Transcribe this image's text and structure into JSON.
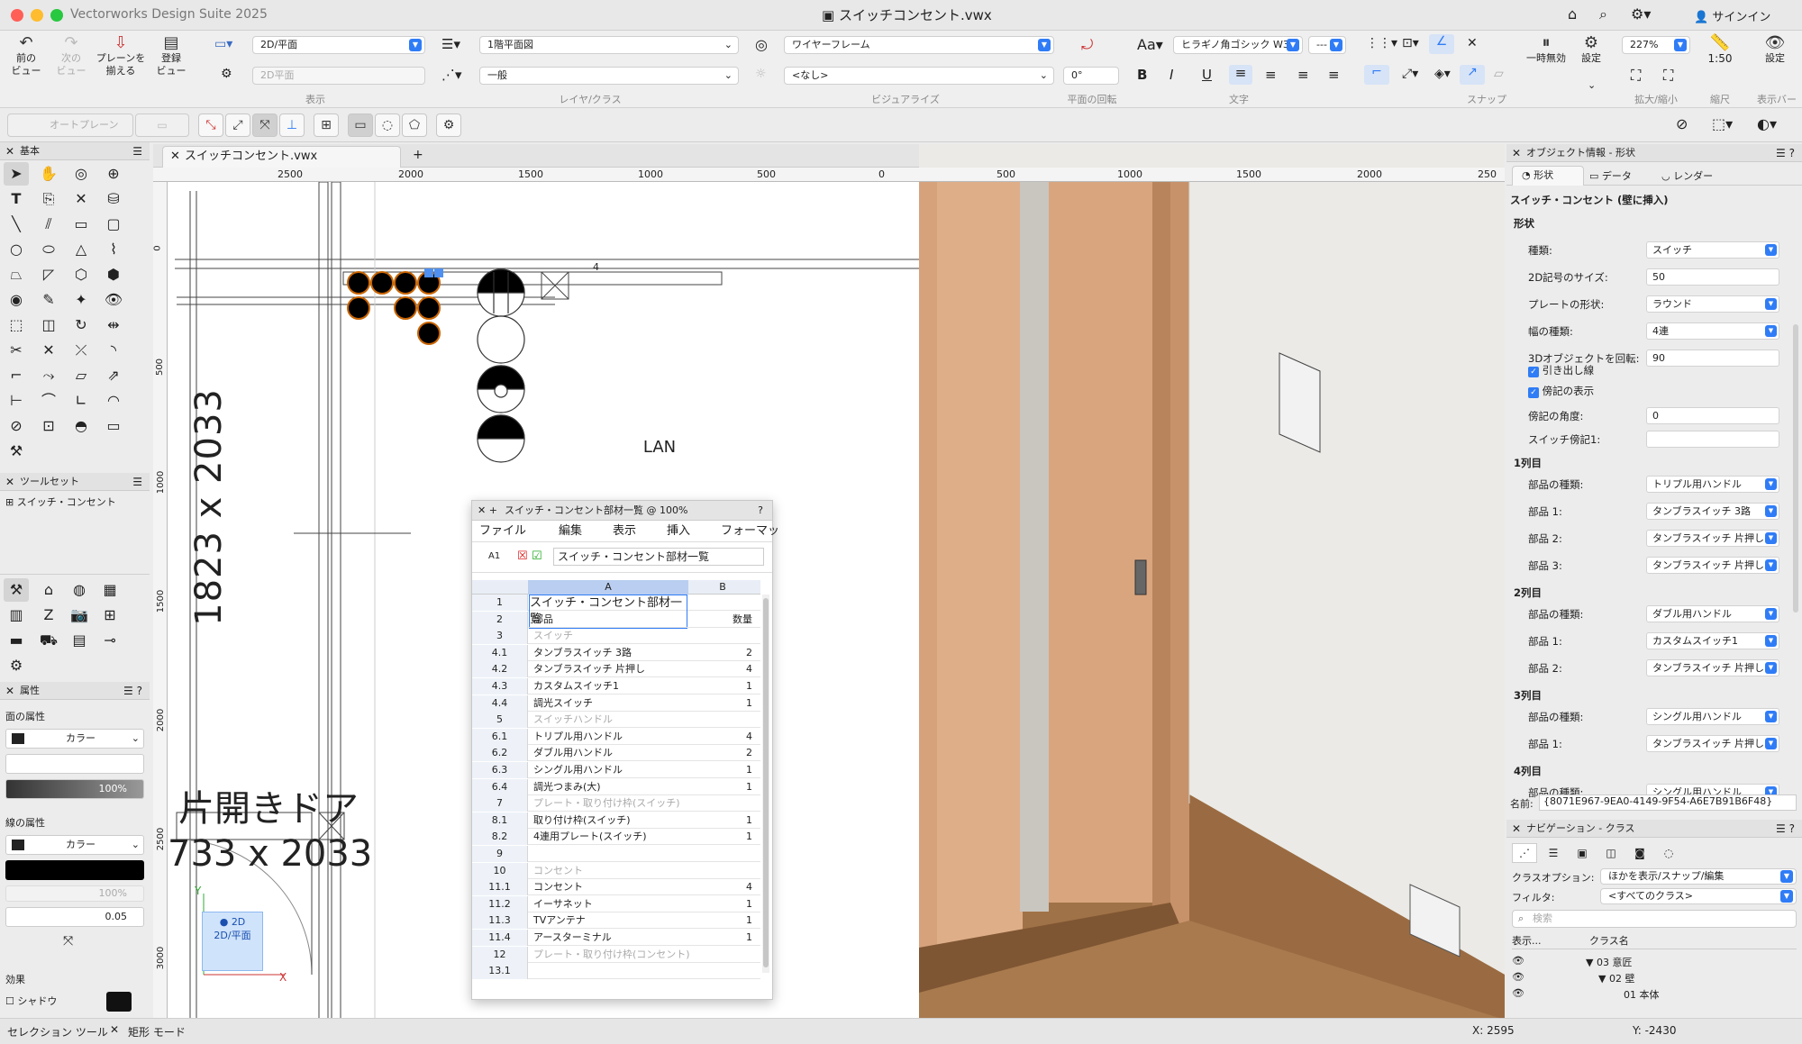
{
  "app": {
    "name": "Vectorworks Design Suite 2025",
    "doc_title": "スイッチコンセント.vwx",
    "signin": "サインイン"
  },
  "colors": {
    "accent": "#2f7cf6",
    "close": "#ff5f57",
    "min": "#febc2e",
    "max": "#28c840"
  },
  "toolbar": {
    "prev_view": "前の\nビュー",
    "next_view": "次の\nビュー",
    "align_planes": "プレーンを\n揃える",
    "register_view": "登録\nビュー",
    "view_dd1": "2D/平面",
    "view_dd2": "2D平面",
    "view_group": "表示",
    "layer_dd": "1階平面図",
    "class_dd": "一般",
    "layer_group": "レイヤ/クラス",
    "render_dd": "ワイヤーフレーム",
    "render_dd2": "<なし>",
    "visualize_group": "ビジュアライズ",
    "rotation": "0°",
    "rotation_group": "平面の回転",
    "font": "ヒラギノ角ゴシック W3",
    "font_size": "---",
    "text_group": "文字",
    "snap_group": "スナップ",
    "pause": "一時無効",
    "settings": "設定",
    "zoom": "227%",
    "zoom_group": "拡大/縮小",
    "scale": "1:50",
    "scale_group": "縮尺",
    "display_settings": "設定",
    "display_group": "表示バー"
  },
  "modebar": {
    "auto_plane": "オートプレーン"
  },
  "basic_palette": {
    "title": "基本"
  },
  "toolset": {
    "title": "ツールセット",
    "item": "スイッチ・コンセント"
  },
  "attributes": {
    "title": "属性",
    "fill_label": "面の属性",
    "fill_type": "カラー",
    "opacity": "100%",
    "line_label": "線の属性",
    "line_type": "カラー",
    "line_opacity": "100%",
    "line_weight": "0.05",
    "effects": "効果",
    "shadow": "シャドウ"
  },
  "doc_tab": "スイッチコンセント.vwx",
  "ruler_top": [
    "2500",
    "2000",
    "1500",
    "1000",
    "500",
    "0",
    "500",
    "1000",
    "1500",
    "2000",
    "250"
  ],
  "ruler_left": [
    "0",
    "500",
    "1000",
    "1500",
    "2000",
    "2500",
    "3000"
  ],
  "drawing": {
    "wall_label1": "1823 x 2033",
    "door_label": "片開きドア",
    "door_size": "733 x 2033",
    "lan": "LAN",
    "plane_badge": "2D/平面",
    "plane_badge_top": "2D",
    "axis_x": "X",
    "axis_y": "Y",
    "num4": "4"
  },
  "sheet": {
    "title": "スイッチ・コンセント部材一覧 @ 100%",
    "menu": [
      "ファイル",
      "編集",
      "表示",
      "挿入",
      "フォーマッ"
    ],
    "cell_ref": "A1",
    "formula": "スイッチ・コンセント部材一覧",
    "col_a": "A",
    "col_b": "B",
    "rows": [
      {
        "n": "1",
        "a": "スイッチ・コンセント部材一覧",
        "b": "",
        "t": "title"
      },
      {
        "n": "2",
        "a": "部品",
        "b": "数量",
        "t": "hdr"
      },
      {
        "n": "3",
        "a": "スイッチ",
        "b": "",
        "t": "g"
      },
      {
        "n": "4.1",
        "a": "タンブラスイッチ 3路",
        "b": "2",
        "t": ""
      },
      {
        "n": "4.2",
        "a": "タンブラスイッチ 片押し",
        "b": "4",
        "t": ""
      },
      {
        "n": "4.3",
        "a": "カスタムスイッチ1",
        "b": "1",
        "t": ""
      },
      {
        "n": "4.4",
        "a": "調光スイッチ",
        "b": "1",
        "t": ""
      },
      {
        "n": "5",
        "a": "スイッチハンドル",
        "b": "",
        "t": "g"
      },
      {
        "n": "6.1",
        "a": "トリプル用ハンドル",
        "b": "4",
        "t": ""
      },
      {
        "n": "6.2",
        "a": "ダブル用ハンドル",
        "b": "2",
        "t": ""
      },
      {
        "n": "6.3",
        "a": "シングル用ハンドル",
        "b": "1",
        "t": ""
      },
      {
        "n": "6.4",
        "a": "調光つまみ(大)",
        "b": "1",
        "t": ""
      },
      {
        "n": "7",
        "a": "プレート・取り付け枠(スイッチ)",
        "b": "",
        "t": "g"
      },
      {
        "n": "8.1",
        "a": "取り付け枠(スイッチ)",
        "b": "1",
        "t": ""
      },
      {
        "n": "8.2",
        "a": "4連用プレート(スイッチ)",
        "b": "1",
        "t": ""
      },
      {
        "n": "9",
        "a": "",
        "b": "",
        "t": ""
      },
      {
        "n": "10",
        "a": "コンセント",
        "b": "",
        "t": "g"
      },
      {
        "n": "11.1",
        "a": "コンセント",
        "b": "4",
        "t": ""
      },
      {
        "n": "11.2",
        "a": "イーサネット",
        "b": "1",
        "t": ""
      },
      {
        "n": "11.3",
        "a": "TVアンテナ",
        "b": "1",
        "t": ""
      },
      {
        "n": "11.4",
        "a": "アースターミナル",
        "b": "1",
        "t": ""
      },
      {
        "n": "12",
        "a": "プレート・取り付け枠(コンセント)",
        "b": "",
        "t": "g"
      },
      {
        "n": "13.1",
        "a": "",
        "b": "",
        "t": ""
      }
    ]
  },
  "objinfo": {
    "title": "オブジェクト情報 - 形状",
    "tabs": [
      "形状",
      "データ",
      "レンダー"
    ],
    "object": "スイッチ・コンセント (壁に挿入)",
    "section_shape": "形状",
    "fields": [
      {
        "label": "種類:",
        "value": "スイッチ",
        "sel": true
      },
      {
        "label": "2D記号のサイズ:",
        "value": "50",
        "sel": false
      },
      {
        "label": "プレートの形状:",
        "value": "ラウンド",
        "sel": true
      },
      {
        "label": "幅の種類:",
        "value": "4連",
        "sel": true
      },
      {
        "label": "3Dオブジェクトを回転:",
        "value": "90",
        "sel": false
      }
    ],
    "check1": "引き出し線",
    "check2": "傍記の表示",
    "angle_label": "傍記の角度:",
    "angle_value": "0",
    "switch_note": "スイッチ傍記1:",
    "col1": "1列目",
    "col1_fields": [
      {
        "label": "部品の種類:",
        "value": "トリプル用ハンドル"
      },
      {
        "label": "部品 1:",
        "value": "タンブラスイッチ 3路"
      },
      {
        "label": "部品 2:",
        "value": "タンブラスイッチ 片押し"
      },
      {
        "label": "部品 3:",
        "value": "タンブラスイッチ 片押し"
      }
    ],
    "col2": "2列目",
    "col2_fields": [
      {
        "label": "部品の種類:",
        "value": "ダブル用ハンドル"
      },
      {
        "label": "部品 1:",
        "value": "カスタムスイッチ1"
      },
      {
        "label": "部品 2:",
        "value": "タンブラスイッチ 片押し"
      }
    ],
    "col3": "3列目",
    "col3_fields": [
      {
        "label": "部品の種類:",
        "value": "シングル用ハンドル"
      },
      {
        "label": "部品 1:",
        "value": "タンブラスイッチ 片押し"
      }
    ],
    "col4": "4列目",
    "col4_fields": [
      {
        "label": "部品の種類:",
        "value": "シングル用ハンドル"
      }
    ],
    "name_label": "名前:",
    "name_value": "{8071E967-9EA0-4149-9F54-A6E7B91B6F48}"
  },
  "nav": {
    "title": "ナビゲーション - クラス",
    "class_opt_label": "クラスオプション:",
    "class_opt": "ほかを表示/スナップ/編集",
    "filter_label": "フィルタ:",
    "filter": "<すべてのクラス>",
    "search": "検索",
    "col_display": "表示...",
    "col_name": "クラス名",
    "rows": [
      "▼ 03 意匠",
      "▼ 02 壁",
      "01 本体"
    ]
  },
  "status": {
    "tool": "セレクション ツール",
    "mode": "矩形 モード",
    "x": "X: 2595",
    "y": "Y: -2430"
  }
}
